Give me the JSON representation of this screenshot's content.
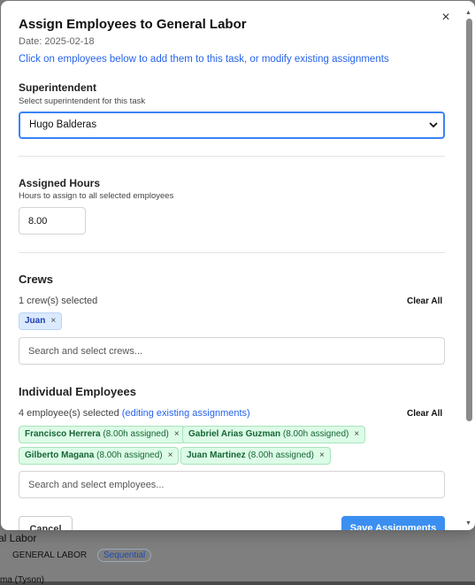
{
  "background": {
    "task_label": "al Labor",
    "task_chip": "GENERAL LABOR",
    "mode_chip": "Sequential",
    "bottom_text": "ma (Tyson)"
  },
  "modal": {
    "title": "Assign Employees to General Labor",
    "date": "Date: 2025-02-18",
    "help_text": "Click on employees below to add them to this task, or modify existing assignments",
    "close_icon": "×"
  },
  "superintendent": {
    "title": "Superintendent",
    "subtitle": "Select superintendent for this task",
    "selected": "Hugo Balderas"
  },
  "hours": {
    "title": "Assigned Hours",
    "subtitle": "Hours to assign to all selected employees",
    "value": "8.00"
  },
  "crews": {
    "title": "Crews",
    "count_text": "1 crew(s) selected",
    "clear_all": "Clear All",
    "chips": [
      {
        "name": "Juan"
      }
    ],
    "search_placeholder": "Search and select crews..."
  },
  "employees": {
    "title": "Individual Employees",
    "count_text": "4 employee(s) selected",
    "edit_note": "(editing existing assignments)",
    "clear_all": "Clear All",
    "chips": [
      {
        "name": "Francisco Herrera",
        "hours": "(8.00h assigned)"
      },
      {
        "name": "Gabriel Arias Guzman",
        "hours": "(8.00h assigned)"
      },
      {
        "name": "Gilberto Magana",
        "hours": "(8.00h assigned)"
      },
      {
        "name": "Juan Martinez",
        "hours": "(8.00h assigned)"
      }
    ],
    "search_placeholder": "Search and select employees..."
  },
  "footer": {
    "cancel": "Cancel",
    "save": "Save Assignments"
  },
  "colors": {
    "accent": "#3b82f6",
    "link": "#2563eb",
    "crew_chip_bg": "#dbeafe",
    "employee_chip_bg": "#dcfce7"
  }
}
